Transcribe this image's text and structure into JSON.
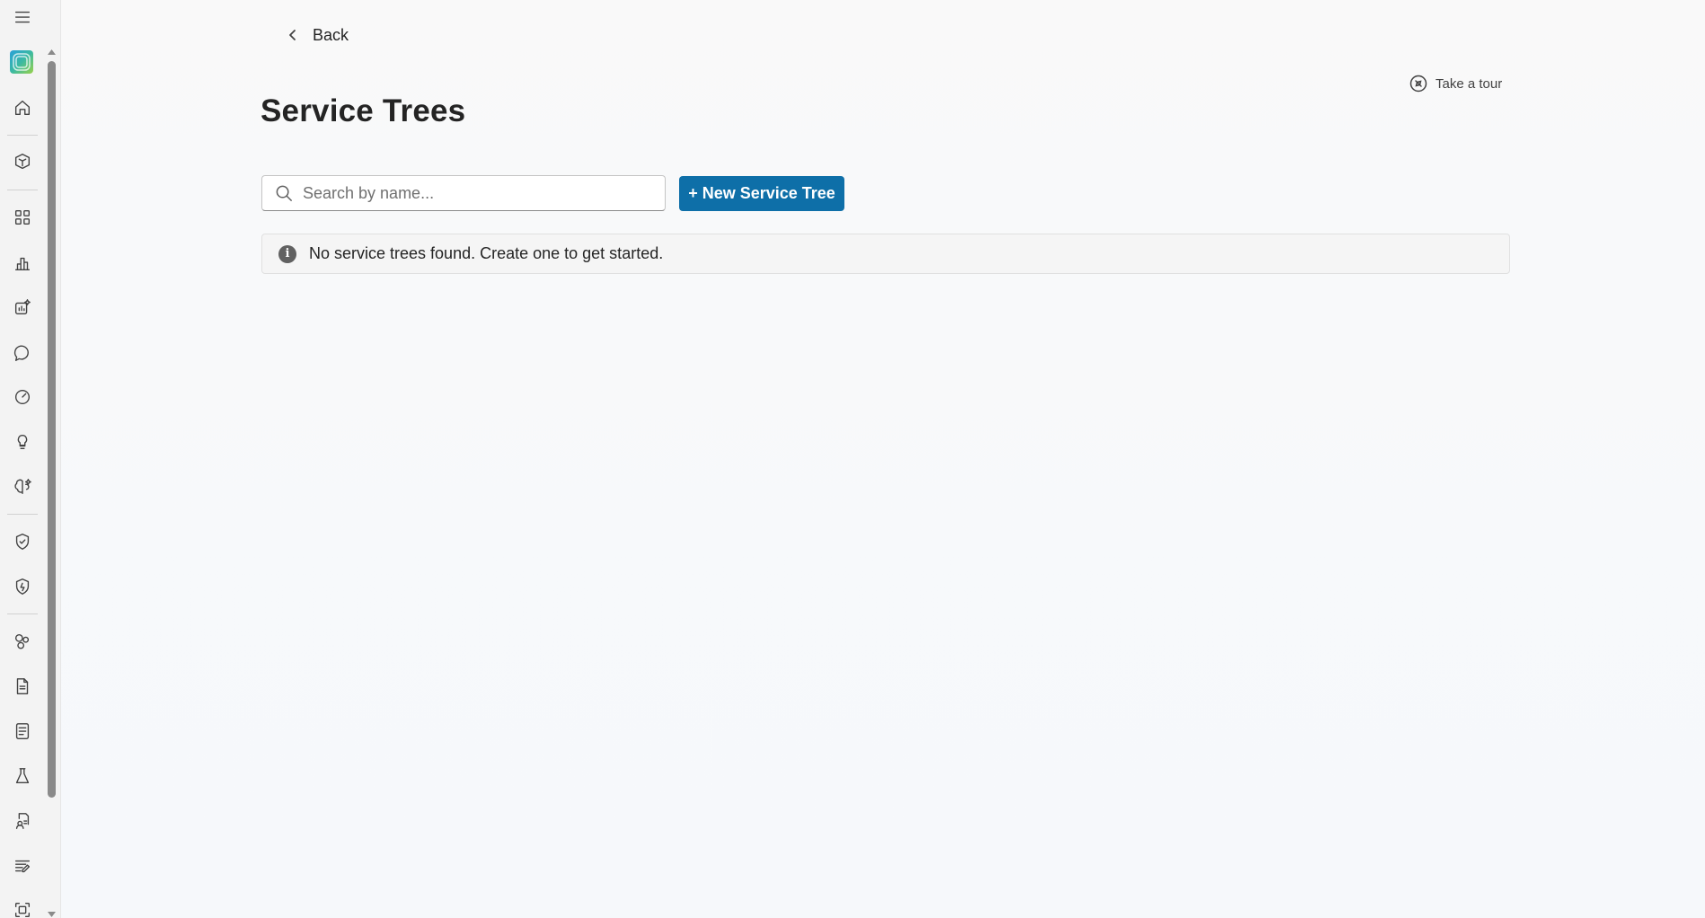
{
  "nav": {
    "back_label": "Back"
  },
  "header": {
    "title": "Service Trees",
    "tour_label": "Take a tour"
  },
  "toolbar": {
    "search_placeholder": "Search by name...",
    "search_value": "",
    "new_button_label": "+ New Service Tree"
  },
  "message": {
    "text": "No service trees found. Create one to get started."
  },
  "sidebar": {
    "items": [
      {
        "icon": "hamburger-menu-icon"
      },
      {
        "icon": "app-logo"
      },
      {
        "icon": "home-icon"
      },
      {
        "icon": "cube-stack-icon"
      },
      {
        "icon": "apps-grid-icon"
      },
      {
        "icon": "bar-chart-icon"
      },
      {
        "icon": "sparkle-chart-icon"
      },
      {
        "icon": "chat-icon"
      },
      {
        "icon": "gauge-icon"
      },
      {
        "icon": "lightbulb-icon"
      },
      {
        "icon": "brain-sparkle-icon"
      },
      {
        "icon": "shield-check-icon"
      },
      {
        "icon": "shield-badge-icon"
      },
      {
        "icon": "shapes-icon"
      },
      {
        "icon": "document-icon"
      },
      {
        "icon": "checklist-document-icon"
      },
      {
        "icon": "beaker-icon"
      },
      {
        "icon": "document-person-icon"
      },
      {
        "icon": "text-edit-icon"
      },
      {
        "icon": "frame-icon"
      }
    ]
  },
  "colors": {
    "primary_button": "#0e6fa8",
    "background": "#f9f9f9",
    "rail": "#f3f3f3"
  }
}
